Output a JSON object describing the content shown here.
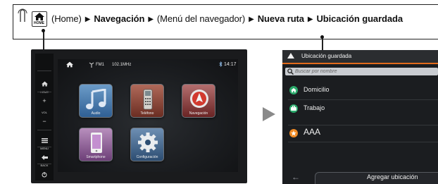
{
  "breadcrumb": {
    "home_badge": "HOME",
    "home_paren": "(Home)",
    "step_1": "Navegación",
    "step_2": "(Menú del navegador)",
    "step_3": "Nueva ruta",
    "step_4": "Ubicación guardada",
    "separator": "▶"
  },
  "head_unit": {
    "side_buttons": {
      "home": "HOME",
      "vol": "VOL",
      "plus": "+",
      "minus": "−",
      "menu": "MENU",
      "back": "BACK"
    },
    "status": {
      "band": "FM1",
      "frequency": "102.1MHz",
      "time": "14:17"
    },
    "apps": [
      {
        "label": "Audio"
      },
      {
        "label": "Teléfono"
      },
      {
        "label": "Navegación"
      },
      {
        "label": "Smartphone"
      },
      {
        "label": "Configuración"
      }
    ]
  },
  "nav_screen": {
    "title": "Ubicación guardada",
    "search_placeholder": "Buscar por nombre",
    "items": [
      {
        "label": "Domicilio",
        "color": "#2aa96a"
      },
      {
        "label": "Trabajo",
        "color": "#2aa96a"
      },
      {
        "label": "AAA",
        "color": "#f08a24"
      }
    ],
    "back_glyph": "←",
    "add_button": "Agregar ubicación"
  },
  "colors": {
    "accent": "#e36b1c",
    "arrow": "#8a8a8a"
  }
}
